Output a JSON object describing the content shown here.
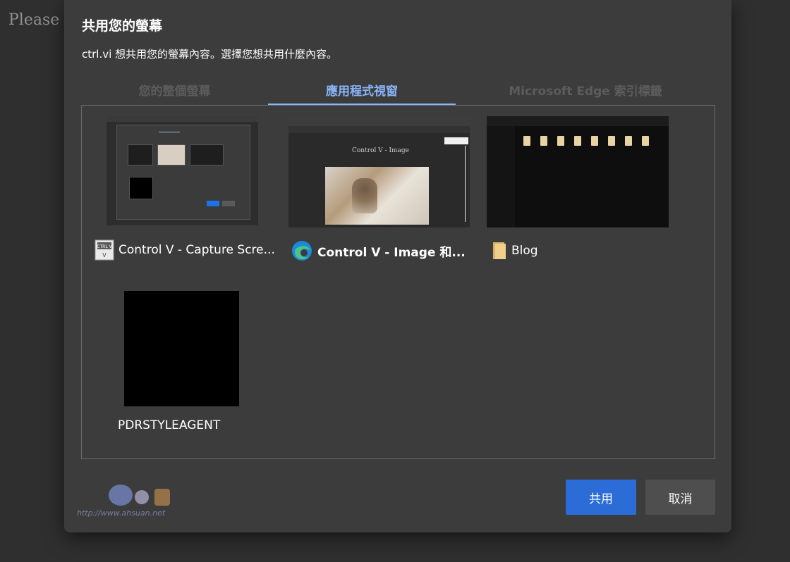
{
  "background": {
    "text": "Please y"
  },
  "dialog": {
    "title": "共用您的螢幕",
    "subtitle": "ctrl.vi 想共用您的螢幕內容。選擇您想共用什麼內容。",
    "tabs": [
      {
        "label": "您的整個螢幕",
        "selected": false
      },
      {
        "label": "應用程式視窗",
        "selected": true
      },
      {
        "label": "Microsoft Edge 索引標籤",
        "selected": false
      }
    ],
    "items": [
      {
        "label": "Control V - Capture Scre...",
        "icon": "control-v-app-icon",
        "icon_text": "CTRL V"
      },
      {
        "label": "Control V - Image 和...",
        "icon": "edge-browser-icon"
      },
      {
        "label": "Blog",
        "icon": "folder-icon"
      },
      {
        "label": "PDRSTYLEAGENT"
      }
    ],
    "thumb_text": {
      "control_v_page_title": "Control V - Image"
    },
    "share_label": "共用",
    "cancel_label": "取消",
    "watermark": {
      "text": "http://www.ahsuan.net"
    }
  },
  "colors": {
    "accent": "#8ab4f8",
    "share_button": "#2b6cd6",
    "dialog_bg": "#3c3c3c"
  }
}
